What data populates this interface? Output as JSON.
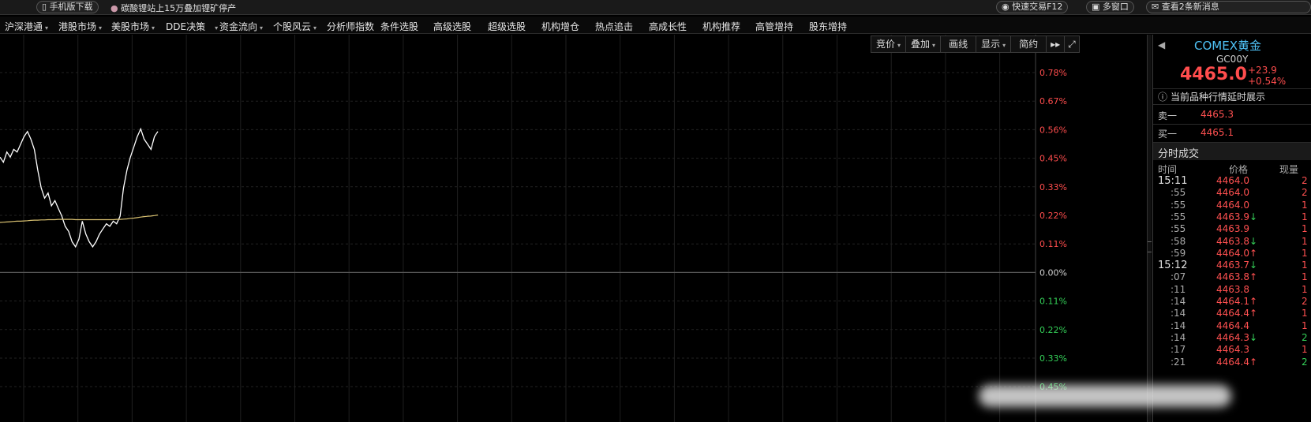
{
  "topbar": {
    "mobile_download": "手机版下载",
    "news": "碳酸锂站上15万叠加锂矿停产",
    "quick_trade": "快速交易F12",
    "multi_window": "多窗口",
    "messages": "查看2条新消息"
  },
  "menu": [
    {
      "label": "沪深港通",
      "dropdown": true
    },
    {
      "label": "港股市场",
      "dropdown": true
    },
    {
      "label": "美股市场",
      "dropdown": true
    },
    {
      "label": "DDE决策",
      "dropdown": true
    },
    {
      "label": "资金流向",
      "dropdown": true
    },
    {
      "label": "个股风云",
      "dropdown": true
    },
    {
      "label": "分析师指数",
      "dropdown": false
    },
    {
      "label": "条件选股",
      "dropdown": false
    },
    {
      "label": "高级选股",
      "dropdown": false
    },
    {
      "label": "超级选股",
      "dropdown": false
    },
    {
      "label": "机构增仓",
      "dropdown": false
    },
    {
      "label": "热点追击",
      "dropdown": false
    },
    {
      "label": "高成长性",
      "dropdown": false
    },
    {
      "label": "机构推荐",
      "dropdown": false
    },
    {
      "label": "高管增持",
      "dropdown": false
    },
    {
      "label": "股东增持",
      "dropdown": false
    }
  ],
  "toolbar": {
    "auction": "竞价",
    "overlay": "叠加",
    "draw": "画线",
    "display": "显示",
    "simple": "简约",
    "next": "▸▸"
  },
  "chart_data": {
    "type": "line",
    "y_tick_labels": [
      "0.78%",
      "0.67%",
      "0.56%",
      "0.45%",
      "0.33%",
      "0.22%",
      "0.11%",
      "0.00%",
      "0.11%",
      "0.22%",
      "0.33%",
      "0.45%"
    ],
    "y_tick_colors": [
      "#ff4d4d",
      "#ff4d4d",
      "#ff4d4d",
      "#ff4d4d",
      "#ff4d4d",
      "#ff4d4d",
      "#ff4d4d",
      "#d0d0d0",
      "#34d058",
      "#34d058",
      "#34d058",
      "#34d058"
    ],
    "ylim_pct": [
      -0.45,
      0.78
    ],
    "series": [
      {
        "color": "#ffffff",
        "values": [
          0.45,
          0.43,
          0.47,
          0.45,
          0.48,
          0.47,
          0.5,
          0.53,
          0.55,
          0.52,
          0.48,
          0.4,
          0.33,
          0.29,
          0.31,
          0.26,
          0.28,
          0.25,
          0.22,
          0.18,
          0.16,
          0.12,
          0.1,
          0.13,
          0.2,
          0.15,
          0.12,
          0.1,
          0.12,
          0.15,
          0.17,
          0.19,
          0.18,
          0.2,
          0.19,
          0.22,
          0.33,
          0.4,
          0.45,
          0.49,
          0.53,
          0.56,
          0.52,
          0.5,
          0.48,
          0.53,
          0.55
        ]
      },
      {
        "color": "#d8c070",
        "values": [
          0.195,
          0.196,
          0.197,
          0.198,
          0.199,
          0.2,
          0.2,
          0.201,
          0.202,
          0.203,
          0.204,
          0.204,
          0.205,
          0.205,
          0.206,
          0.206,
          0.206,
          0.207,
          0.207,
          0.207,
          0.207,
          0.207,
          0.206,
          0.206,
          0.206,
          0.206,
          0.206,
          0.206,
          0.206,
          0.206,
          0.206,
          0.206,
          0.206,
          0.206,
          0.207,
          0.207,
          0.208,
          0.209,
          0.211,
          0.212,
          0.214,
          0.216,
          0.218,
          0.219,
          0.22,
          0.222,
          0.224
        ]
      }
    ]
  },
  "quote": {
    "name": "COMEX黄金",
    "code": "GC00Y",
    "price": "4465.0",
    "change": "+23.9",
    "change_pct": "+0.54%",
    "notice": "当前品种行情延时展示",
    "ask_label": "卖一",
    "ask_price": "4465.3",
    "bid_label": "买一",
    "bid_price": "4465.1",
    "ticks_title": "分时成交",
    "col_time": "时间",
    "col_price": "价格",
    "col_vol": "现量"
  },
  "trades": [
    {
      "time": "15:11",
      "price": "4464.0",
      "arrow": "",
      "vol": "2",
      "vol_dir": "up"
    },
    {
      "time": ":55",
      "price": "4464.0",
      "arrow": "",
      "vol": "2",
      "vol_dir": "up"
    },
    {
      "time": ":55",
      "price": "4464.0",
      "arrow": "",
      "vol": "1",
      "vol_dir": "up"
    },
    {
      "time": ":55",
      "price": "4463.9",
      "arrow": "down",
      "vol": "1",
      "vol_dir": "up"
    },
    {
      "time": ":55",
      "price": "4463.9",
      "arrow": "",
      "vol": "1",
      "vol_dir": "up"
    },
    {
      "time": ":58",
      "price": "4463.8",
      "arrow": "down",
      "vol": "1",
      "vol_dir": "up"
    },
    {
      "time": ":59",
      "price": "4464.0",
      "arrow": "up",
      "vol": "1",
      "vol_dir": "up"
    },
    {
      "time": "15:12",
      "price": "4463.7",
      "arrow": "down",
      "vol": "1",
      "vol_dir": "up"
    },
    {
      "time": ":07",
      "price": "4463.8",
      "arrow": "up",
      "vol": "1",
      "vol_dir": "up"
    },
    {
      "time": ":11",
      "price": "4463.8",
      "arrow": "",
      "vol": "1",
      "vol_dir": "up"
    },
    {
      "time": ":14",
      "price": "4464.1",
      "arrow": "up",
      "vol": "2",
      "vol_dir": "up"
    },
    {
      "time": ":14",
      "price": "4464.4",
      "arrow": "up",
      "vol": "1",
      "vol_dir": "up"
    },
    {
      "time": ":14",
      "price": "4464.4",
      "arrow": "",
      "vol": "1",
      "vol_dir": "up"
    },
    {
      "time": ":14",
      "price": "4464.3",
      "arrow": "down",
      "vol": "2",
      "vol_dir": "down"
    },
    {
      "time": ":17",
      "price": "4464.3",
      "arrow": "",
      "vol": "1",
      "vol_dir": "up"
    },
    {
      "time": ":21",
      "price": "4464.4",
      "arrow": "up",
      "vol": "2",
      "vol_dir": "down"
    }
  ]
}
